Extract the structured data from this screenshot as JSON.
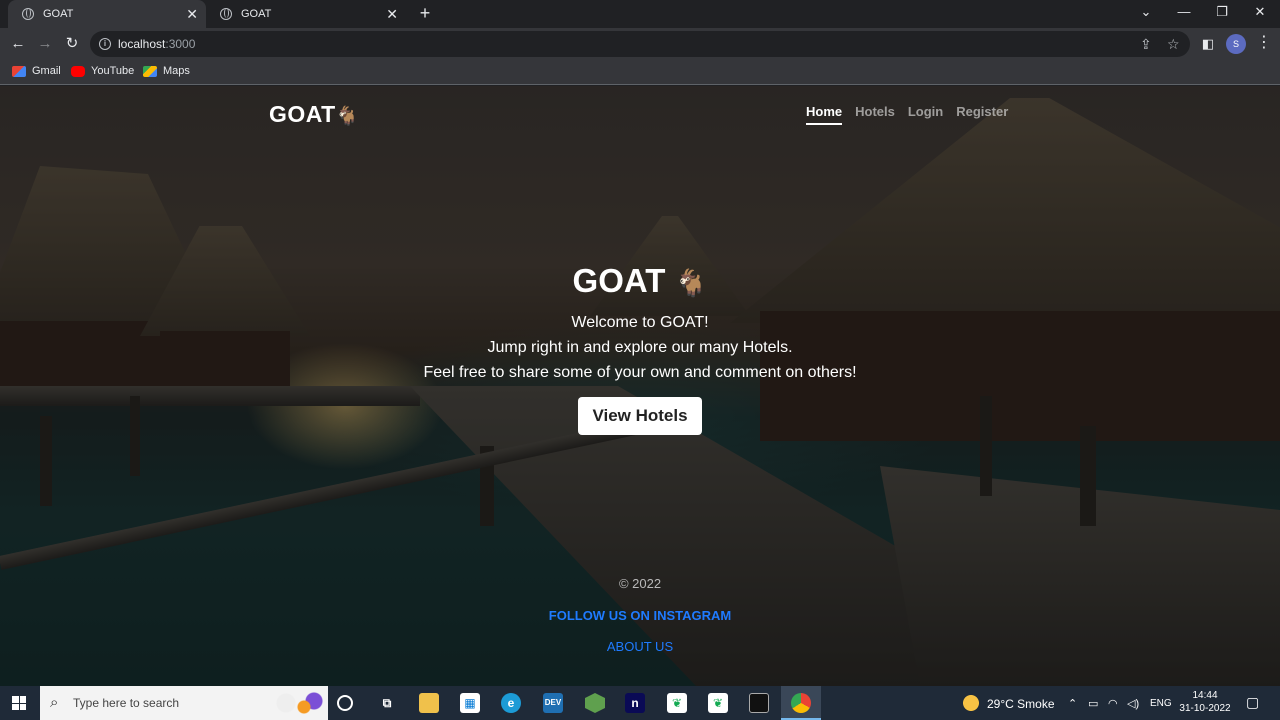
{
  "browser": {
    "tabs": [
      {
        "title": "GOAT",
        "active": true
      },
      {
        "title": "GOAT",
        "active": false
      }
    ],
    "address": {
      "host": "localhost",
      "port": ":3000"
    },
    "profile_initial": "S",
    "bookmarks": [
      "Gmail",
      "YouTube",
      "Maps"
    ]
  },
  "site": {
    "brand": "GOAT",
    "brand_emoji": "🐐",
    "nav": [
      {
        "label": "Home",
        "active": true
      },
      {
        "label": "Hotels",
        "active": false
      },
      {
        "label": "Login",
        "active": false
      },
      {
        "label": "Register",
        "active": false
      }
    ],
    "hero": {
      "title": "GOAT",
      "lines": [
        "Welcome to GOAT!",
        "Jump right in and explore our many Hotels.",
        "Feel free to share some of your own and comment on others!"
      ],
      "button": "View Hotels"
    },
    "footer": {
      "copyright": "© 2022",
      "instagram": "FOLLOW US ON INSTAGRAM",
      "about": "ABOUT US"
    }
  },
  "taskbar": {
    "search_placeholder": "Type here to search",
    "weather": "29°C  Smoke",
    "language": "ENG",
    "time": "14:44",
    "date": "31-10-2022"
  },
  "colors": {
    "link_blue": "#1f7bff",
    "chrome_dark": "#202124",
    "chrome_toolbar": "#35363a"
  }
}
